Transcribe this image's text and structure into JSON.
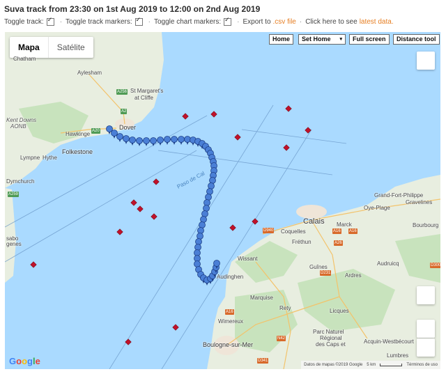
{
  "title": "Suva track from 23:30 on 1st Aug 2019 to 12:00 on 2nd Aug 2019",
  "toolbar": {
    "toggle_track": "Toggle track:",
    "toggle_track_markers": "Toggle track markers:",
    "toggle_chart_markers": "Toggle chart markers:",
    "export_prefix": "Export to",
    "export_link": ".csv file",
    "latest_prefix": "Click here to see",
    "latest_link": "latest data."
  },
  "map": {
    "type_buttons": {
      "map": "Mapa",
      "satellite": "Satélite"
    },
    "controls": {
      "home": "Home",
      "set_home": "Set Home",
      "set_home_icon": "dropdown-arrow",
      "full_screen": "Full screen",
      "distance_tool": "Distance tool"
    },
    "google_logo": "Google",
    "attribution": {
      "data": "Datos de mapas ©2019 Google",
      "scale": "5 km",
      "terms": "Términos de uso"
    },
    "places": {
      "chatham": "Chatham",
      "aylesham": "Aylesham",
      "st_margarets": "St Margaret's",
      "at_cliffe": "at Cliffe",
      "dover": "Dover",
      "kent_downs": "Kent Downs",
      "aonb": "AONB",
      "hawkinge": "Hawkinge",
      "folkestone": "Folkestone",
      "lympne": "Lympne",
      "hythe": "Hythe",
      "dymchurch": "Dymchurch",
      "paso_de_calais": "Paso de Cal",
      "grand_fort_philippe": "Grand-Fort-Philippe",
      "gravelines": "Gravelines",
      "oye_plage": "Oye-Plage",
      "calais": "Calais",
      "marck": "Marck",
      "coquelles": "Coquelles",
      "frethun": "Fréthun",
      "bourbourg": "Bourbourg",
      "wissant": "Wissant",
      "guines": "Guînes",
      "audruicq": "Audruicq",
      "ardres": "Ardres",
      "audinghen": "Audinghen",
      "marquise": "Marquise",
      "rety": "Rety",
      "licques": "Licques",
      "wimereux": "Wimereux",
      "boulogne": "Boulogne-sur-Mer",
      "parc_1": "Parc Naturel",
      "parc_2": "Régional",
      "parc_3": "des Caps et",
      "acquin": "Acquin-Westbécourt",
      "lumbres": "Lumbres",
      "sabo": "sabo",
      "genes": "genes"
    },
    "roads": {
      "a256": "A256",
      "a2": "A2",
      "a20": "A20",
      "a259": "A259",
      "d940": "D940",
      "a16_1": "A16",
      "a16_2": "A16",
      "d231": "D231",
      "d300": "D300",
      "a26": "A26",
      "n42": "N42",
      "d341": "D341",
      "a16_3": "A16"
    },
    "track_color": "#4a7fd6",
    "marker_color": "#c0112a",
    "sea_color": "#aadaff",
    "land_color": "#e8eee0"
  }
}
